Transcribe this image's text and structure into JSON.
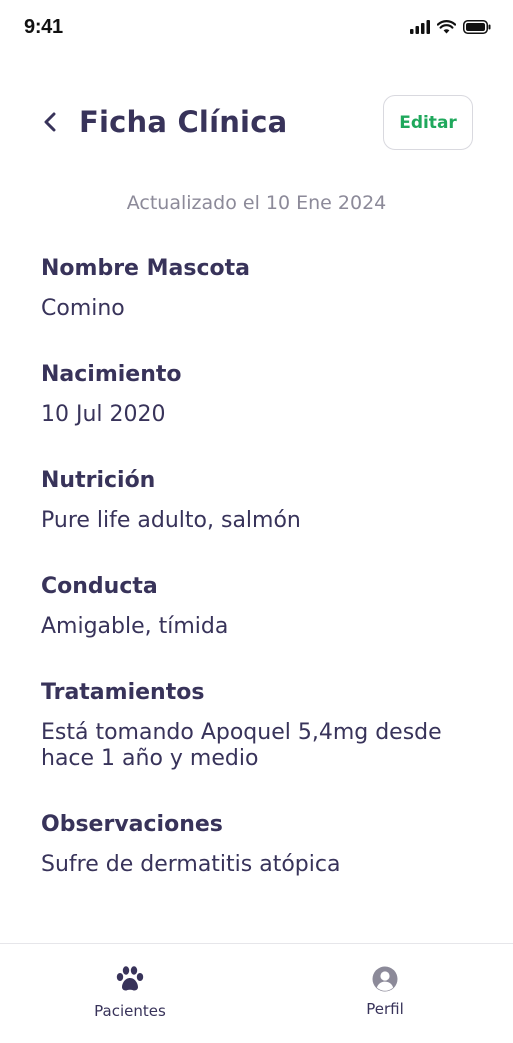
{
  "status_bar": {
    "time": "9:41"
  },
  "header": {
    "title": "Ficha Clínica",
    "edit_label": "Editar"
  },
  "updated_text": "Actualizado el 10 Ene 2024",
  "fields": [
    {
      "label": "Nombre Mascota",
      "value": "Comino"
    },
    {
      "label": "Nacimiento",
      "value": "10 Jul 2020"
    },
    {
      "label": "Nutrición",
      "value": "Pure life adulto, salmón"
    },
    {
      "label": "Conducta",
      "value": "Amigable, tímida"
    },
    {
      "label": "Tratamientos",
      "value": "Está tomando Apoquel 5,4mg desde hace 1 año y medio"
    },
    {
      "label": "Observaciones",
      "value": "Sufre de dermatitis atópica"
    }
  ],
  "bottom_nav": {
    "items": [
      {
        "label": "Pacientes",
        "icon": "paw-icon"
      },
      {
        "label": "Perfil",
        "icon": "user-circle-icon"
      }
    ]
  },
  "colors": {
    "text_primary": "#38335a",
    "text_muted": "#8c8a99",
    "accent_green": "#1fa85c",
    "border": "#d9d9df"
  }
}
